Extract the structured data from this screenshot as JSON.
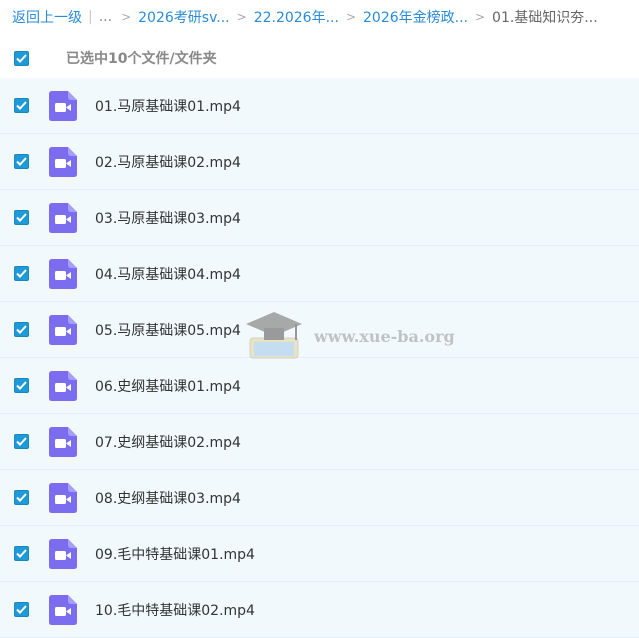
{
  "breadcrumb": {
    "back": "返回上一级",
    "sep_bar": "|",
    "ellipsis": "...",
    "sep": ">",
    "items": [
      "2026考研sv...",
      "22.2026年...",
      "2026年金榜政..."
    ],
    "current": "01.基础知识夯..."
  },
  "selection": {
    "text": "已选中10个文件/文件夹",
    "checked": true
  },
  "files": [
    {
      "name": "01.马原基础课01.mp4",
      "checked": true,
      "icon": "video-file-icon"
    },
    {
      "name": "02.马原基础课02.mp4",
      "checked": true,
      "icon": "video-file-icon"
    },
    {
      "name": "03.马原基础课03.mp4",
      "checked": true,
      "icon": "video-file-icon"
    },
    {
      "name": "04.马原基础课04.mp4",
      "checked": true,
      "icon": "video-file-icon"
    },
    {
      "name": "05.马原基础课05.mp4",
      "checked": true,
      "icon": "video-file-icon"
    },
    {
      "name": "06.史纲基础课01.mp4",
      "checked": true,
      "icon": "video-file-icon"
    },
    {
      "name": "07.史纲基础课02.mp4",
      "checked": true,
      "icon": "video-file-icon"
    },
    {
      "name": "08.史纲基础课03.mp4",
      "checked": true,
      "icon": "video-file-icon"
    },
    {
      "name": "09.毛中特基础课01.mp4",
      "checked": true,
      "icon": "video-file-icon"
    },
    {
      "name": "10.毛中特基础课02.mp4",
      "checked": true,
      "icon": "video-file-icon"
    }
  ],
  "watermark": {
    "text": "www.xue-ba.org"
  },
  "colors": {
    "link": "#2a8bd8",
    "checkbox": "#1f9ad6",
    "row_bg": "#f2f9fd",
    "video_icon": "#7b6cf0"
  }
}
